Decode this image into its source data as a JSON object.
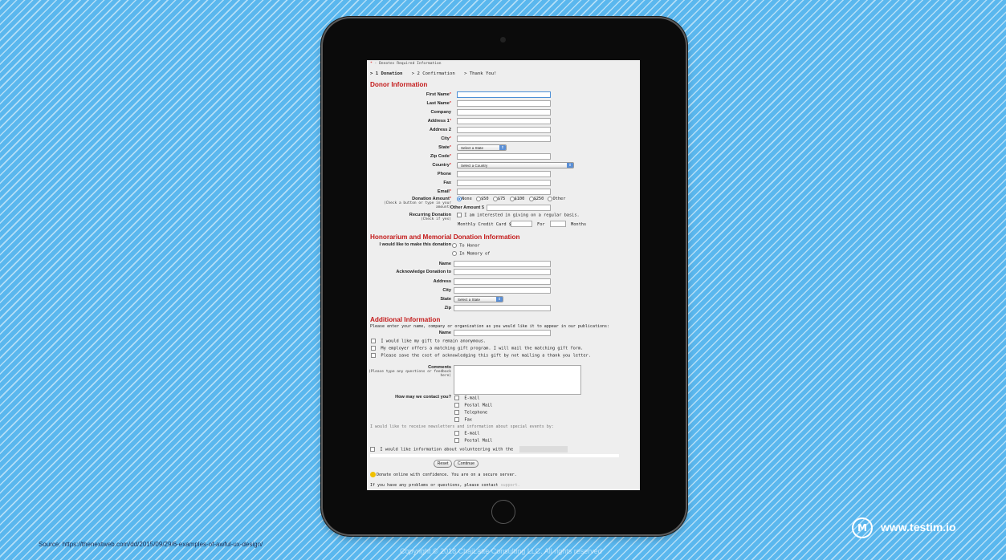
{
  "form": {
    "required_star": "*",
    "required_note": " - Denotes Required Information",
    "steps": [
      "> 1 Donation",
      "> 2 Confirmation",
      "> Thank You!"
    ],
    "donor": {
      "heading": "Donor Information",
      "first_name": "First Name",
      "last_name": "Last Name",
      "company": "Company",
      "address1": "Address 1",
      "address2": "Address 2",
      "city": "City",
      "state": "State",
      "state_select": "Select a State",
      "zip": "Zip Code",
      "country": "Country",
      "country_select": "Select a Country",
      "phone": "Phone",
      "fax": "Fax",
      "email": "Email",
      "donation_amount": "Donation Amount",
      "donation_hint": "(Check a button or type in your amount)",
      "amount_options": [
        "None",
        "$50",
        "$75",
        "$100",
        "$250",
        "Other"
      ],
      "other_amount": "Other Amount",
      "dollar": "$",
      "recurring": "Recurring Donation",
      "recurring_hint": "(Check if yes)",
      "recurring_text": "I am interested in giving on a regular basis.",
      "monthly_card": "Monthly Credit Card $",
      "for_label": "For",
      "months": "Months"
    },
    "honorarium": {
      "heading": "Honorarium and Memorial Donation Information",
      "make_donation": "I would like to make this donation",
      "to_honor": "To Honor",
      "in_memory": "In Memory of",
      "name": "Name",
      "acknowledge": "Acknowledge Donation to",
      "address": "Address",
      "city": "City",
      "state": "State",
      "state_select": "Select a State",
      "zip": "Zip"
    },
    "additional": {
      "heading": "Additional Information",
      "instructions": "Please enter your name, company or organization as you would like it to appear in our publications:",
      "name": "Name",
      "check_anonymous": "I would like my gift to remain anonymous.",
      "check_employer": "My employer offers a matching gift program. I will mail the matching gift form.",
      "check_save": "Please save the cost of acknowledging this gift by not mailing a thank you letter.",
      "comments": "Comments",
      "comments_hint": "(Please type any questions or feedback here)",
      "contact_q": "How may we contact you?",
      "contact_opts": [
        "E-mail",
        "Postal Mail",
        "Telephone",
        "Fax"
      ],
      "newsletter": "I would like to receive newsletters and information about special events by:",
      "news_opts": [
        "E-mail",
        "Postal Mail"
      ],
      "volunteer": "I would like information about volunteering with the"
    },
    "reset": "Reset",
    "continue": "Continue",
    "secure": "Donate online with confidence. You are on a secure server.",
    "problems": "If you have any problems or questions, please contact",
    "support": "support."
  },
  "slide": {
    "logo_letter": "M",
    "site": "www.testim.io",
    "source": "Source: https://thenextweb.com/dd/2015/09/29/6-examples-of-awful-ux-design/",
    "copyright": "Copyright © 2018 ChaiLatte Consulting LLC. All rights reserved"
  },
  "colors": {
    "background": "#5ab7ee",
    "heading_red": "#c41c1c",
    "tablet": "#0b0b0b"
  }
}
